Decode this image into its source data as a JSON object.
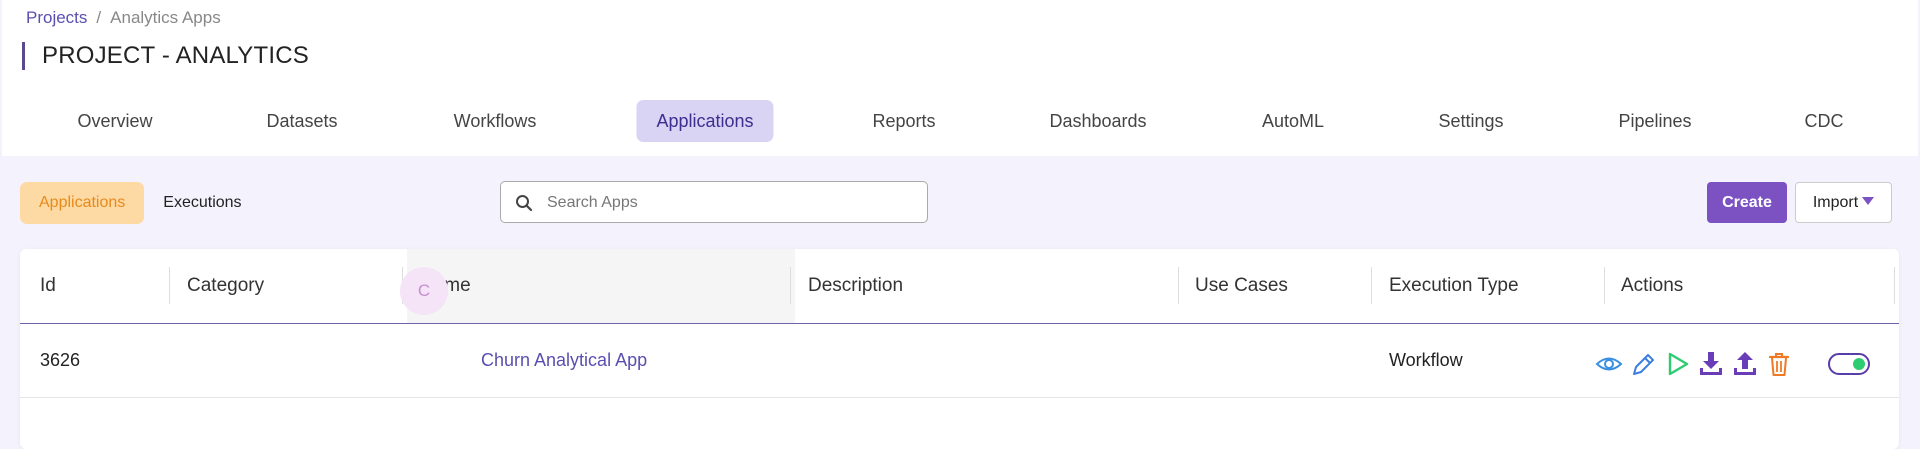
{
  "breadcrumb": {
    "root": "Projects",
    "separator": "/",
    "current": "Analytics Apps"
  },
  "page": {
    "title": "PROJECT - ANALYTICS"
  },
  "tabs": [
    {
      "label": "Overview"
    },
    {
      "label": "Datasets"
    },
    {
      "label": "Workflows"
    },
    {
      "label": "Applications",
      "active": true
    },
    {
      "label": "Reports"
    },
    {
      "label": "Dashboards"
    },
    {
      "label": "AutoML"
    },
    {
      "label": "Settings"
    },
    {
      "label": "Pipelines"
    },
    {
      "label": "CDC"
    }
  ],
  "subtabs": {
    "applications": "Applications",
    "executions": "Executions"
  },
  "search": {
    "placeholder": "Search Apps",
    "value": ""
  },
  "buttons": {
    "create": "Create",
    "import": "Import"
  },
  "table": {
    "columns": [
      "Id",
      "Category",
      "Name",
      "Description",
      "Use Cases",
      "Execution Type",
      "Actions"
    ],
    "rows": [
      {
        "id": "3626",
        "category": "",
        "avatar_letter": "C",
        "name": "Churn Analytical App",
        "description": "",
        "use_cases": "",
        "execution_type": "Workflow",
        "enabled": true
      }
    ]
  },
  "colors": {
    "accent": "#7c52c2",
    "active_tab_bg": "#d9d3f4",
    "active_subtab_bg": "#fdd9a3",
    "active_subtab_text": "#e78a1c",
    "toggle_on": "#2ecc71"
  },
  "icons": [
    "search-icon",
    "eye-icon",
    "pencil-icon",
    "play-icon",
    "download-icon",
    "upload-icon",
    "trash-icon"
  ]
}
